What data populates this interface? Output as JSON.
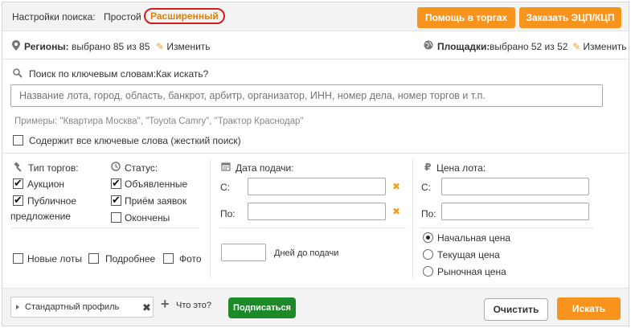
{
  "header": {
    "title": "Настройки поиска:",
    "mode_simple": "Простой",
    "mode_advanced": "Расширенный",
    "help_button": "Помощь в торгах",
    "order_button": "Заказать ЭЦП/КЦП"
  },
  "regions": {
    "label": "Регионы:",
    "value": "выбрано 85 из 85",
    "edit": "Изменить"
  },
  "platforms": {
    "label": "Площадки:",
    "value": "выбрано 52 из 52",
    "edit": "Изменить"
  },
  "keyword_search": {
    "label": "Поиск по ключевым словам:",
    "how_link": "Как искать?",
    "placeholder": "Название лота, город, область, банкрот, арбитр, организатор, ИНН, номер дела, номер торгов и т.п.",
    "examples": "Примеры: \"Квартира Москва\", \"Toyota Camry\", \"Трактор Краснодар\"",
    "strict_label": "Содержит все ключевые слова (жесткий поиск)",
    "strict_checked": false
  },
  "trade_type": {
    "label": "Тип торгов:",
    "options": [
      {
        "label": "Аукцион",
        "checked": true
      },
      {
        "label": "Публичное",
        "label2": "предложение",
        "checked": true
      }
    ]
  },
  "status": {
    "label": "Статус:",
    "options": [
      {
        "label": "Объявленные",
        "checked": true
      },
      {
        "label": "Приём заявок",
        "checked": true
      },
      {
        "label": "Окончены",
        "checked": false
      }
    ]
  },
  "extras": {
    "new_lots": "Новые лоты",
    "details": "Подробнее",
    "photo": "Фото"
  },
  "submit_date": {
    "label": "Дата подачи:",
    "from": "С:",
    "to": "По:",
    "days_label": "Дней до подачи"
  },
  "price": {
    "label": "Цена лота:",
    "from": "С:",
    "to": "По:",
    "options": [
      {
        "label": "Начальная цена",
        "checked": true
      },
      {
        "label": "Текущая цена",
        "checked": false
      },
      {
        "label": "Рыночная цена",
        "checked": false
      }
    ]
  },
  "footer": {
    "profile": "Стандартный профиль",
    "what_is": "Что это?",
    "subscribe": "Подписаться",
    "clear": "Очистить",
    "search": "Искать"
  },
  "colors": {
    "accent": "#f7941d",
    "link": "#d8820c",
    "green": "#1d8a2a"
  }
}
